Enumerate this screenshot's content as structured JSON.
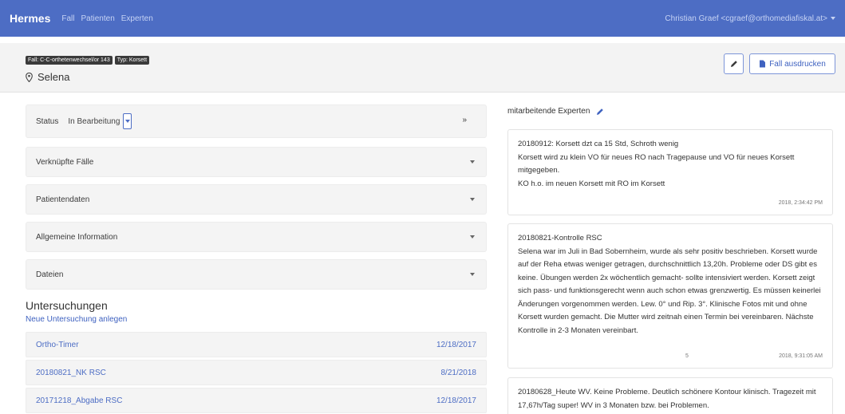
{
  "navbar": {
    "brand": "Hermes",
    "links": [
      "Fall",
      "Patienten",
      "Experten"
    ],
    "user": "Christian Graef <cgraef@orthomediafiskal.at>"
  },
  "case": {
    "badges": [
      "Fall: C-C-orthetenwechsel/or 143",
      "Typ: Korsett"
    ],
    "patient_name": "Selena",
    "print_label": "Fall ausdrucken"
  },
  "panels": {
    "status_label": "Status",
    "status_value": "In Bearbeitung",
    "linked_cases": "Verknüpfte Fälle",
    "patient_data": "Patientendaten",
    "general_info": "Allgemeine Information",
    "files": "Dateien"
  },
  "exams": {
    "title": "Untersuchungen",
    "new_link": "Neue Untersuchung anlegen",
    "rows": [
      {
        "name": "Ortho-Timer",
        "date": "12/18/2017"
      },
      {
        "name": "20180821_NK RSC",
        "date": "8/21/2018"
      },
      {
        "name": "20171218_Abgabe RSC",
        "date": "12/18/2017"
      }
    ]
  },
  "experts": {
    "label": "mitarbeitende Experten"
  },
  "notes": [
    {
      "text": "20180912: Korsett dzt ca 15 Std, Schroth wenig\nKorsett wird zu klein VO für neues RO nach Tragepause und VO für neues Korsett mitgegeben.\nKO h.o. im neuen Korsett mit RO im Korsett",
      "time": "2018, 2:34:42 PM"
    },
    {
      "text": "20180821-Kontrolle RSC\nSelena war im Juli in Bad Sobernheim, wurde als sehr positiv beschrieben. Korsett wurde auf der Reha etwas weniger getragen, durchschnittlich 13,20h. Probleme oder DS gibt es keine. Übungen werden 2x wöchentlich gemacht- sollte intensiviert werden. Korsett zeigt sich pass- und funktionsgerecht wenn auch schon etwas grenzwertig. Es müssen keinerlei Änderungen vorgenommen werden. Lew. 0° und Rip. 3°. Klinische Fotos mit und ohne Korsett wurden gemacht. Die Mutter wird zeitnah einen Termin bei vereinbaren. Nächste Kontrolle in 2-3 Monaten vereinbart.",
      "page": "5",
      "time": "2018, 9:31:05 AM"
    },
    {
      "text": "20180628_Heute WV. Keine Probleme. Deutlich schönere Kontour klinisch. Tragezeit mit 17,67h/Tag super! WV in 3 Monaten bzw. bei Problemen."
    }
  ]
}
